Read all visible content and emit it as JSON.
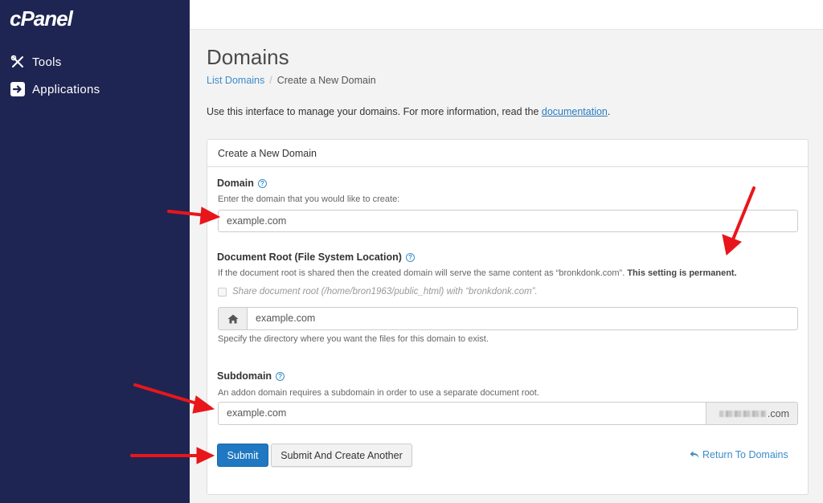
{
  "sidebar": {
    "logo": "cPanel",
    "items": [
      {
        "label": "Tools",
        "icon": "tools-icon"
      },
      {
        "label": "Applications",
        "icon": "applications-icon"
      }
    ]
  },
  "page": {
    "title": "Domains",
    "breadcrumb": {
      "link": "List Domains",
      "separator": "/",
      "current": "Create a New Domain"
    },
    "intro_prefix": "Use this interface to manage your domains. For more information, read the ",
    "intro_link": "documentation",
    "intro_suffix": "."
  },
  "form": {
    "heading": "Create a New Domain",
    "domain": {
      "label": "Domain",
      "hint": "Enter the domain that you would like to create:",
      "value": "example.com"
    },
    "docroot": {
      "label": "Document Root (File System Location)",
      "hint": "If the document root is shared then the created domain will serve the same content as “bronkdonk.com”.",
      "hint_bold": "This setting is permanent.",
      "checkbox_label": "Share document root (/home/bron1963/public_html) with “bronkdonk.com”.",
      "value": "example.com",
      "help_text": "Specify the directory where you want the files for this domain to exist."
    },
    "subdomain": {
      "label": "Subdomain",
      "hint": "An addon domain requires a subdomain in order to use a separate document root.",
      "value": "example.com",
      "suffix": ".com"
    },
    "buttons": {
      "submit": "Submit",
      "submit_another": "Submit And Create Another",
      "return": "Return To Domains"
    }
  },
  "colors": {
    "sidebar_bg": "#1f2552",
    "primary": "#1f78c1",
    "link": "#3a8cc9",
    "annotation_arrow": "#e8161b"
  }
}
